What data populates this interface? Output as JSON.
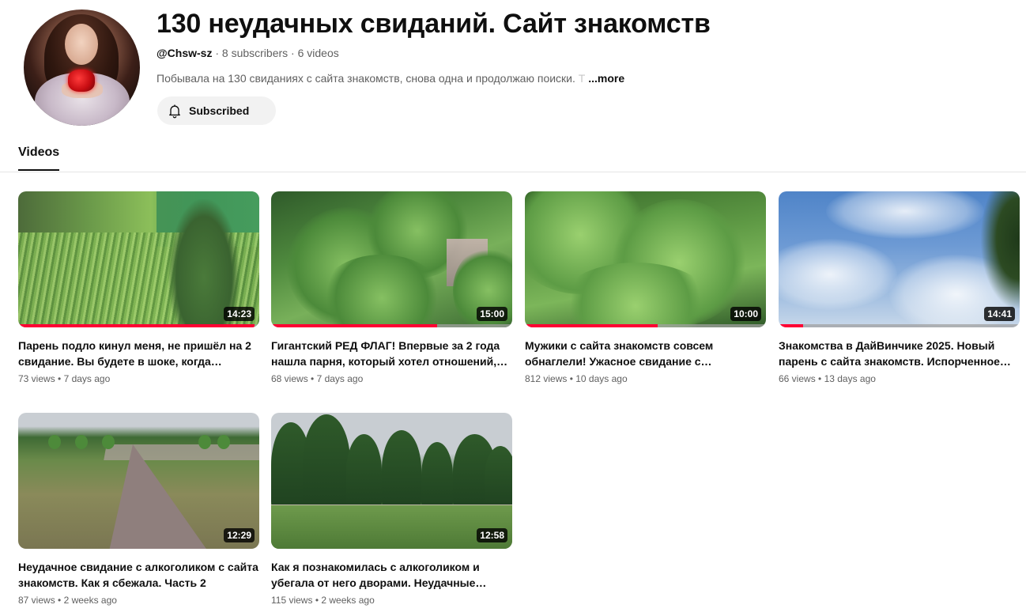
{
  "channel": {
    "title": "130 неудачных свиданий. Сайт знакомств",
    "handle": "@Chsw-sz",
    "subscribers": "8 subscribers",
    "videos_count": "6 videos",
    "meta_separator": " · ",
    "description": "Побывала на 130 свиданиях с сайта знакомств, снова одна и продолжаю поиски.",
    "description_fade": " Т",
    "more_label": "...more",
    "subscribe_label": "Subscribed",
    "avatar_icon": "avatar-woman-with-heart"
  },
  "tabs": [
    {
      "label": "Videos",
      "active": true
    }
  ],
  "colors": {
    "progress": "#ff0033",
    "text_primary": "#0f0f0f",
    "text_secondary": "#606060",
    "chip_bg": "#f2f2f2"
  },
  "videos": [
    {
      "title": "Парень подло кинул меня, не пришёл на 2 свидание. Вы будете в шоке, когда…",
      "duration": "14:23",
      "views": "73 views",
      "age": "7 days ago",
      "watched_percent": 98
    },
    {
      "title": "Гигантский РЕД ФЛАГ! Впервые за 2 года нашла парня, который хотел отношений,…",
      "duration": "15:00",
      "views": "68 views",
      "age": "7 days ago",
      "watched_percent": 69
    },
    {
      "title": "Мужики с сайта знакомств совсем обнаглели! Ужасное свидание с…",
      "duration": "10:00",
      "views": "812 views",
      "age": "10 days ago",
      "watched_percent": 55
    },
    {
      "title": "Знакомства в ДайВинчике 2025. Новый парень с сайта знакомств. Испорченное…",
      "duration": "14:41",
      "views": "66 views",
      "age": "13 days ago",
      "watched_percent": 10
    },
    {
      "title": "Неудачное свидание с алкоголиком с сайта знакомств. Как я сбежала. Часть 2",
      "duration": "12:29",
      "views": "87 views",
      "age": "2 weeks ago",
      "watched_percent": 0
    },
    {
      "title": "Как я познакомилась с алкоголиком и убегала от него дворами. Неудачные…",
      "duration": "12:58",
      "views": "115 views",
      "age": "2 weeks ago",
      "watched_percent": 0
    }
  ]
}
